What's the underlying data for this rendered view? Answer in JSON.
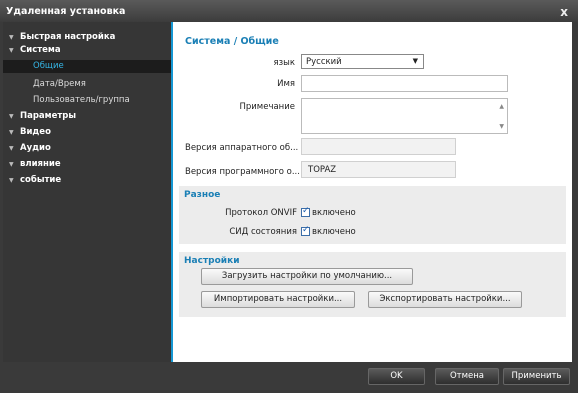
{
  "window": {
    "title": "Удаленная установка",
    "close": "x"
  },
  "sidebar": {
    "items": [
      {
        "label": "Быстрая настройка"
      },
      {
        "label": "Система"
      },
      {
        "label": "Параметры"
      },
      {
        "label": "Видео"
      },
      {
        "label": "Аудио"
      },
      {
        "label": "влияние"
      },
      {
        "label": "событие"
      }
    ],
    "subitems": [
      {
        "label": "Общие",
        "active": true
      },
      {
        "label": "Дата/Время"
      },
      {
        "label": "Пользователь/группа"
      }
    ]
  },
  "main": {
    "heading": "Система / Общие",
    "language_label": "язык",
    "language_value": "Русский",
    "name_label": "Имя",
    "name_value": "",
    "note_label": "Примечание",
    "note_value": "",
    "hw_label": "Версия аппаратного об...",
    "hw_value": "",
    "sw_label": "Версия программного о...",
    "sw_value": "TOPAZ"
  },
  "misc": {
    "heading": "Разное",
    "onvif_label": "Протокол ONVIF",
    "onvif_value": "включено",
    "led_label": "СИД состояния",
    "led_value": "включено"
  },
  "settings": {
    "heading": "Настройки",
    "default_button": "Загрузить настройки по умолчанию...",
    "import_button": "Импортировать настройки...",
    "export_button": "Экспортировать настройки..."
  },
  "footer": {
    "ok": "OK",
    "cancel": "Отмена",
    "apply": "Применить"
  },
  "icons": {
    "expand": "triangle-down-icon",
    "dropdown": "chevron-down-icon",
    "checkbox": "check-icon"
  }
}
